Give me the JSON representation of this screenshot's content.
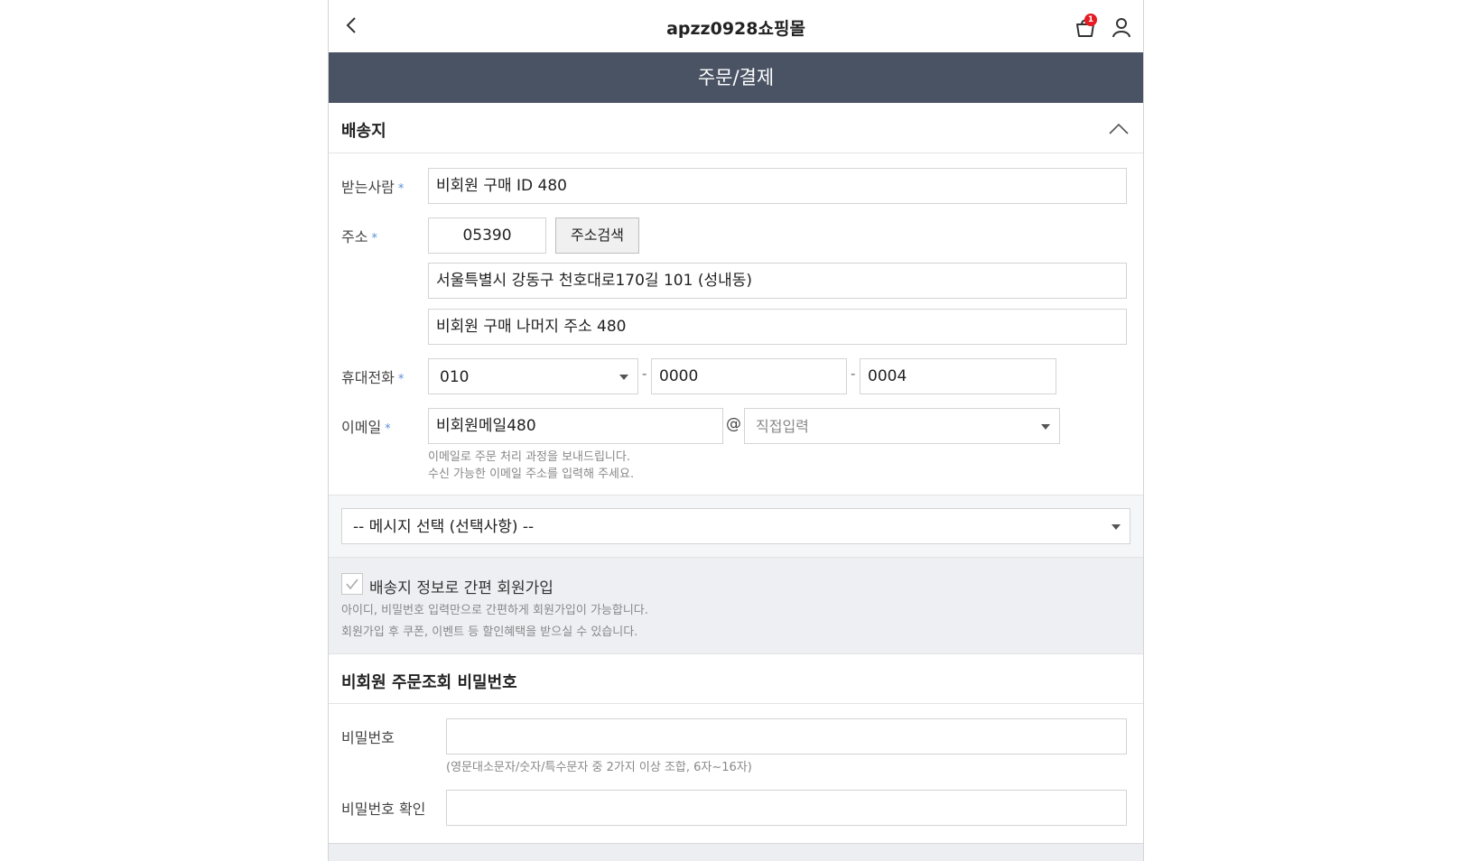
{
  "topbar": {
    "title": "apzz0928쇼핑몰",
    "cart_badge": "1"
  },
  "header": {
    "title": "주문/결제"
  },
  "shipping": {
    "section_title": "배송지",
    "recipient_label": "받는사람",
    "recipient_value": "비회원 구매 ID 480",
    "address_label": "주소",
    "zipcode": "05390",
    "address_search_button": "주소검색",
    "address1": "서울특별시 강동구 천호대로170길 101 (성내동)",
    "address2": "비회원 구매 나머지 주소 480",
    "phone_label": "휴대전화",
    "phone1": "010",
    "phone_sep": "-",
    "phone2": "0000",
    "phone3": "0004",
    "email_label": "이메일",
    "email_id": "비회원메일480",
    "email_at": "@",
    "email_domain_placeholder": "직접입력",
    "email_help_line1": "이메일로 주문 처리 과정을 보내드립니다.",
    "email_help_line2": "수신 가능한 이메일 주소를 입력해 주세요.",
    "required_mark": "*"
  },
  "message": {
    "select_value": "-- 메시지 선택 (선택사항) --"
  },
  "join": {
    "checkbox_label": "배송지 정보로 간편 회원가입",
    "help_line1": "아이디, 비밀번호 입력만으로 간편하게 회원가입이 가능합니다.",
    "help_line2": "회원가입 후 쿠폰, 이벤트 등 할인혜택을 받으실 수 있습니다."
  },
  "guest_password": {
    "section_title": "비회원 주문조회 비밀번호",
    "password_label": "비밀번호",
    "password_help": "(영문대소문자/숫자/특수문자 중 2가지 이상 조합, 6자~16자)",
    "confirm_label": "비밀번호 확인"
  },
  "colors": {
    "header_bg": "#4a5363",
    "required_star": "#5b8fd6",
    "badge": "#e51c23"
  },
  "icons": [
    "back-arrow-icon",
    "cart-icon",
    "user-icon",
    "chevron-up-icon",
    "checkmark-icon",
    "dropdown-arrow-icon"
  ]
}
